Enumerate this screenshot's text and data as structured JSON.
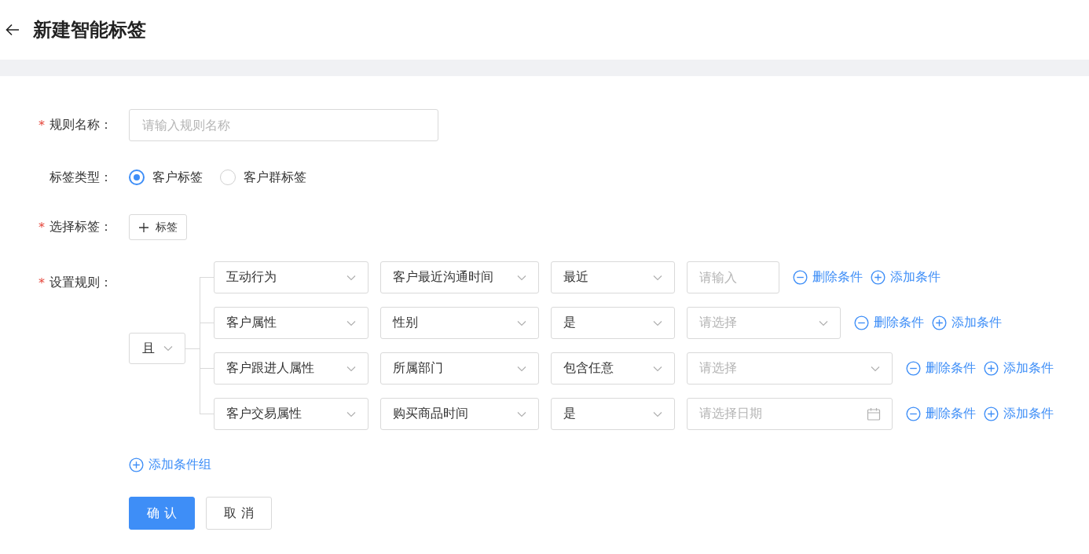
{
  "header": {
    "title": "新建智能标签"
  },
  "form": {
    "rule_name": {
      "required_mark": "*",
      "label": "规则名称：",
      "placeholder": "请输入规则名称"
    },
    "tag_type": {
      "label": "标签类型：",
      "options": [
        {
          "label": "客户标签",
          "selected": true
        },
        {
          "label": "客户群标签",
          "selected": false
        }
      ]
    },
    "select_tag": {
      "required_mark": "*",
      "label": "选择标签：",
      "button": "标签"
    },
    "rules": {
      "required_mark": "*",
      "label": "设置规则：",
      "logic": "且",
      "conditions": [
        {
          "fields": [
            {
              "kind": "select",
              "value": "互动行为"
            },
            {
              "kind": "select",
              "value": "客户最近沟通时间"
            },
            {
              "kind": "select",
              "value": "最近"
            },
            {
              "kind": "input",
              "placeholder": "请输入"
            }
          ],
          "delete": "删除条件",
          "add": "添加条件"
        },
        {
          "fields": [
            {
              "kind": "select",
              "value": "客户属性"
            },
            {
              "kind": "select",
              "value": "性别"
            },
            {
              "kind": "select",
              "value": "是"
            },
            {
              "kind": "select",
              "placeholder": "请选择"
            }
          ],
          "delete": "删除条件",
          "add": "添加条件"
        },
        {
          "fields": [
            {
              "kind": "select",
              "value": "客户跟进人属性"
            },
            {
              "kind": "select",
              "value": "所属部门"
            },
            {
              "kind": "select",
              "value": "包含任意"
            },
            {
              "kind": "select",
              "placeholder": "请选择"
            }
          ],
          "delete": "删除条件",
          "add": "添加条件"
        },
        {
          "fields": [
            {
              "kind": "select",
              "value": "客户交易属性"
            },
            {
              "kind": "select",
              "value": "购买商品时间"
            },
            {
              "kind": "select",
              "value": "是"
            },
            {
              "kind": "date",
              "placeholder": "请选择日期"
            }
          ],
          "delete": "删除条件",
          "add": "添加条件"
        }
      ],
      "add_group": "添加条件组"
    }
  },
  "buttons": [
    {
      "label": "确 认",
      "kind": "primary"
    },
    {
      "label": "取 消",
      "kind": "default"
    }
  ]
}
